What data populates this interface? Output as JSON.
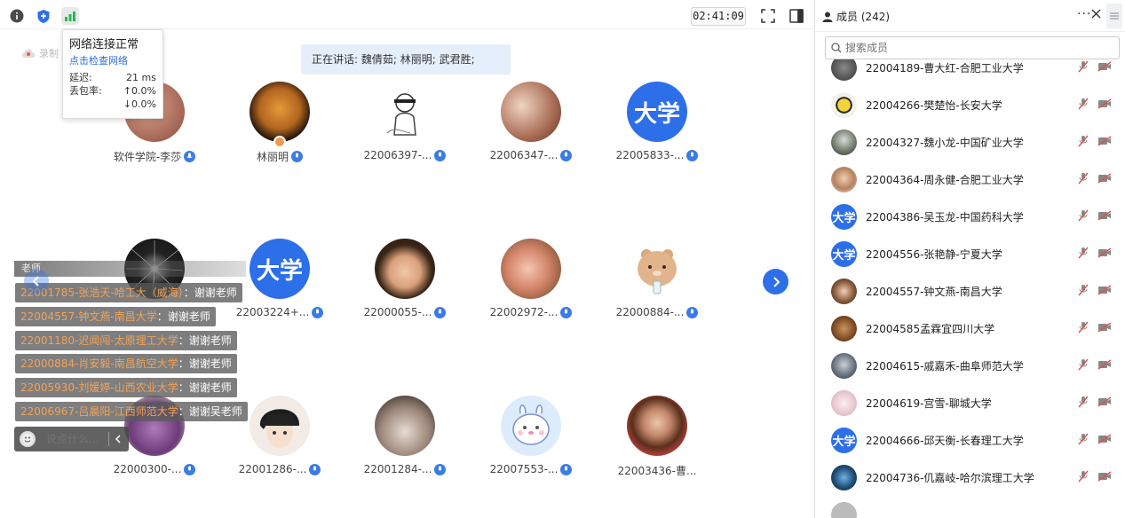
{
  "toolbar": {
    "timer": "02:41:09",
    "icons": [
      "info-icon",
      "shield-icon",
      "signal-icon",
      "fullscreen-icon",
      "side-panel-icon"
    ]
  },
  "network_popover": {
    "title": "网络连接正常",
    "link": "点击检查网络",
    "latency_label": "延迟:",
    "latency_value": "21 ms",
    "loss_label": "丢包率:",
    "loss_up": "↑0.0%",
    "loss_down": "↓0.0%"
  },
  "speaking": "正在讲话: 魏倩茹; 林丽明; 武君胜;",
  "cloud_recording": "录制",
  "tiles": [
    {
      "name": "软件学院-李莎"
    },
    {
      "name": "林丽明"
    },
    {
      "name": "22006397-..."
    },
    {
      "name": "22006347-..."
    },
    {
      "name": "22005833-...",
      "avatar_text": "大学"
    },
    {
      "name": ""
    },
    {
      "name": "22003224+...",
      "avatar_text": "大学"
    },
    {
      "name": "22000055-..."
    },
    {
      "name": "22002972-..."
    },
    {
      "name": "22000884-..."
    },
    {
      "name": "22000300-..."
    },
    {
      "name": "22001286-..."
    },
    {
      "name": "22001284-..."
    },
    {
      "name": "22007553-..."
    },
    {
      "name": "22003436-曹..."
    }
  ],
  "chat": {
    "header": "老师",
    "messages": [
      {
        "who": "22001785-张浩天-哈工大（威海）",
        "text": "：谢谢老师"
      },
      {
        "who": "22004557-钟文燕-南昌大学",
        "text": "：谢谢老师"
      },
      {
        "who": "22001180-迟闻闯-太原理工大学",
        "text": "：谢谢老师"
      },
      {
        "who": "22000884-肖安毅-南昌航空大学",
        "text": "：谢谢老师"
      },
      {
        "who": "22005930-刘媛婷-山西农业大学",
        "text": "：谢谢老师"
      },
      {
        "who": "22006967-吕晨阳-江西师范大学",
        "text": "：谢谢吴老师"
      }
    ],
    "input_placeholder": "说点什么..."
  },
  "members": {
    "title": "成员 (242)",
    "search_placeholder": "搜索成员",
    "list": [
      {
        "name": "22004189-曹大红-合肥工业大学"
      },
      {
        "name": "22004266-樊楚怡-长安大学"
      },
      {
        "name": "22004327-魏小龙-中国矿业大学"
      },
      {
        "name": "22004364-周永健-合肥工业大学"
      },
      {
        "name": "22004386-吴玉龙-中国药科大学",
        "avatar_text": "大学"
      },
      {
        "name": "22004556-张艳静-宁夏大学",
        "avatar_text": "大学"
      },
      {
        "name": "22004557-钟文燕-南昌大学"
      },
      {
        "name": "22004585孟霖宜四川大学"
      },
      {
        "name": "22004615-戚嘉禾-曲阜师范大学"
      },
      {
        "name": "22004619-宫雪-聊城大学"
      },
      {
        "name": "22004666-邱天衡-长春理工大学",
        "avatar_text": "大学"
      },
      {
        "name": "22004736-仉嘉岐-哈尔滨理工大学"
      }
    ]
  },
  "colors": {
    "accent_blue": "#2d6fe8",
    "chat_name_orange": "#f0a35a",
    "muted_red": "#d9534f"
  }
}
